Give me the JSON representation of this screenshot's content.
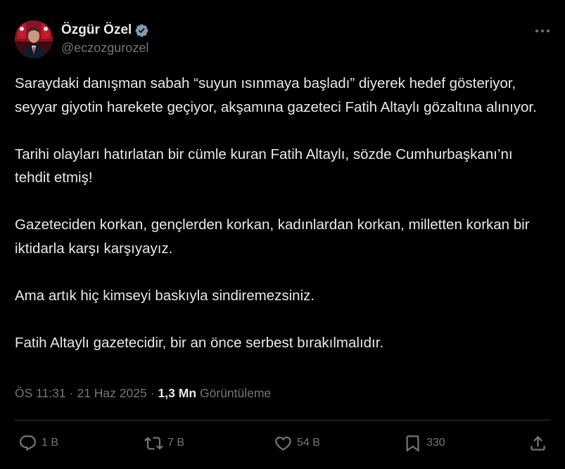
{
  "author": {
    "display_name": "Özgür Özel",
    "handle": "@eczozgurozel",
    "verified": true
  },
  "tweet": {
    "paragraphs": [
      "Saraydaki danışman sabah “suyun ısınmaya başladı” diyerek hedef gösteriyor, seyyar giyotin harekete geçiyor, akşamına gazeteci Fatih Altaylı gözaltına alınıyor.",
      "Tarihi olayları hatırlatan bir cümle kuran Fatih Altaylı, sözde Cumhurbaşkanı’nı tehdit etmiş!",
      "Gazeteciden korkan, gençlerden korkan, kadınlardan korkan, milletten korkan bir iktidarla karşı karşıyayız.",
      "Ama artık hiç kimseyi baskıyla sindiremezsiniz.",
      "Fatih Altaylı gazetecidir, bir an önce serbest bırakılmalıdır."
    ]
  },
  "meta": {
    "time": "ÖS 11:31",
    "separator": "·",
    "date": "21 Haz 2025",
    "views_count": "1,3 Mn",
    "views_label": "Görüntüleme"
  },
  "actions": {
    "replies": "1 B",
    "reposts": "7 B",
    "likes": "54 B",
    "bookmarks": "330"
  },
  "icons": {
    "more": "more-horizontal-icon",
    "verified": "verified-badge-icon",
    "reply": "reply-icon",
    "repost": "repost-icon",
    "like": "heart-icon",
    "bookmark": "bookmark-icon",
    "share": "share-icon"
  },
  "colors": {
    "background": "#000000",
    "text": "#e7e9ea",
    "secondary": "#71767b",
    "verified": "#829aab",
    "divider": "#2f3336"
  }
}
